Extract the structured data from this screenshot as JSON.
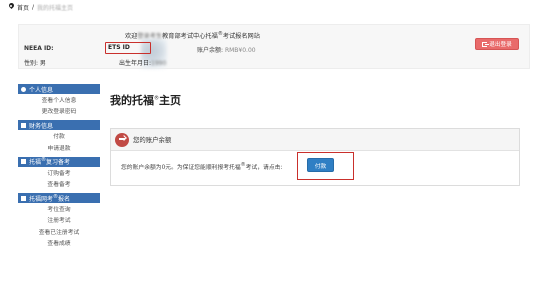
{
  "breadcrumb": {
    "home": "首页",
    "current": "我的托福主页"
  },
  "header": {
    "welcome_prefix": "欢迎",
    "welcome_name": "登录考生",
    "welcome_org": "教育部考试中心托福",
    "welcome_suffix": "考试报名网站",
    "neea_label": "NEEA ID:",
    "ets_label": "ETS ID",
    "gender_label": "性别: 男",
    "birth_label": "出生年月日:",
    "birth_value": "1990",
    "balance_label": "账户余额:",
    "balance_value": "RMB¥0.00",
    "logout": "退出登录"
  },
  "sidebar": {
    "sections": [
      {
        "title": "个人信息",
        "items": [
          "查看个人信息",
          "更改登录密码"
        ]
      },
      {
        "title": "财务信息",
        "items": [
          "付款",
          "申请退款"
        ]
      },
      {
        "title_pre": "托福",
        "title_post": "复习备考",
        "items": [
          "订购备考",
          "查看备考"
        ]
      },
      {
        "title_pre": "托福网考",
        "title_post": "报名",
        "items": [
          "考位查询",
          "注册考试",
          "查看已注册考试",
          "查看成绩"
        ]
      }
    ]
  },
  "main": {
    "title_pre": "我的托福",
    "title_post": "主页",
    "card_title": "您的账户余额",
    "body_pre": "您的账户余额为0元。为保证您能顺利报考托福",
    "body_post": "考试，请点击:",
    "pay_button": "付款"
  },
  "colors": {
    "sidebar_header": "#3a6fb0",
    "logout_button": "#e96b6b",
    "pay_button": "#2f7fc4",
    "highlight_box": "#c9302c"
  }
}
